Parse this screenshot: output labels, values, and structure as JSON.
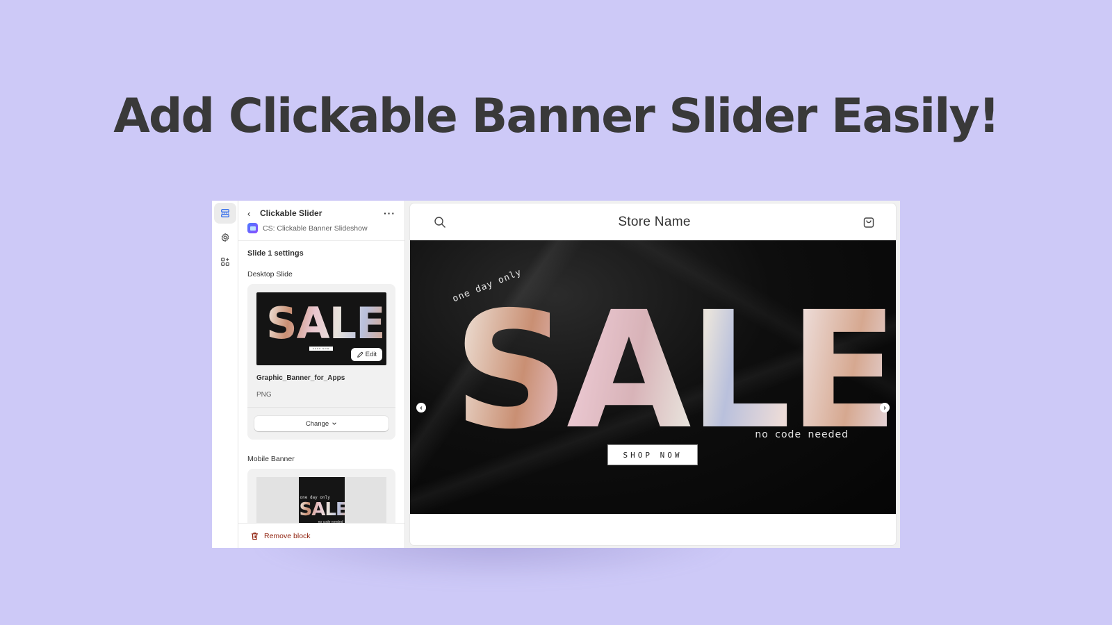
{
  "headline": "Add Clickable Banner Slider Easily!",
  "rail": {
    "items": [
      {
        "icon": "sections-icon",
        "active": true
      },
      {
        "icon": "gear-icon",
        "active": false
      },
      {
        "icon": "apps-icon",
        "active": false
      }
    ]
  },
  "panel": {
    "back_glyph": "‹",
    "title": "Clickable Slider",
    "more_glyph": "···",
    "subtitle": "CS: Clickable Banner Slideshow",
    "section_title": "Slide 1 settings",
    "desktop": {
      "label": "Desktop Slide",
      "edit_label": "Edit",
      "file_name": "Graphic_Banner_for_Apps",
      "file_type": "PNG",
      "change_label": "Change"
    },
    "mobile": {
      "label": "Mobile Banner",
      "thumb_top_text": "one day only",
      "thumb_sale": "SALE",
      "thumb_bottom_text": "no code needed"
    },
    "remove_label": "Remove block",
    "remove_color": "#8e1f0b"
  },
  "preview": {
    "store_name": "Store Name",
    "banner": {
      "top_text": "one day only",
      "sale_text": "SALE",
      "bottom_text": "no code needed",
      "cta_label": "SHOP NOW",
      "prev_glyph": "‹",
      "next_glyph": "›"
    },
    "thumb": {
      "sale_text": "SALE",
      "cta_label": "SHOP NOW"
    }
  },
  "colors": {
    "background": "#cdc9f7",
    "headline": "#393939",
    "accent": "#4b7bff"
  }
}
